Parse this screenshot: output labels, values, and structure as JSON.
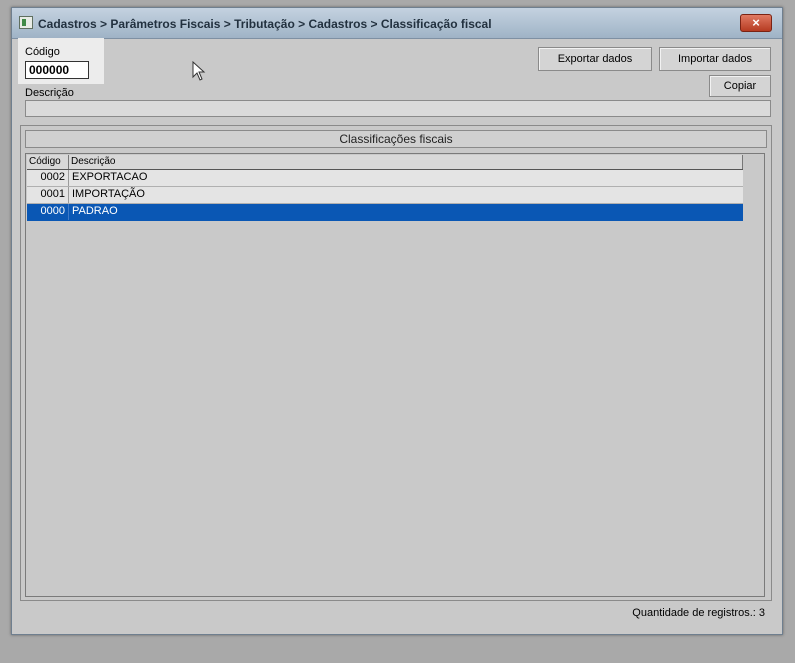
{
  "window": {
    "title": "Cadastros > Parâmetros Fiscais > Tributação > Cadastros > Classificação fiscal",
    "close_symbol": "×"
  },
  "form": {
    "codigo_label": "Código",
    "codigo_value": "000000",
    "descricao_label": "Descrição",
    "descricao_value": ""
  },
  "toolbar": {
    "exportar_label": "Exportar dados",
    "importar_label": "Importar dados",
    "copiar_label": "Copiar"
  },
  "grid": {
    "title": "Classificações fiscais",
    "columns": {
      "codigo": "Código",
      "descricao": "Descrição"
    },
    "rows": [
      {
        "codigo": "0002",
        "descricao": "EXPORTACAO"
      },
      {
        "codigo": "0001",
        "descricao": "IMPORTAÇÃO"
      },
      {
        "codigo": "0000",
        "descricao": "PADRAO"
      }
    ],
    "selected_index": 2
  },
  "footer": {
    "record_count_text": "Quantidade de registros.: 3"
  },
  "colors": {
    "selection": "#0a57b4",
    "window_bg": "#c9c9c9",
    "close_button": "#c14a31"
  },
  "icons": {
    "app": "app-icon",
    "close": "close-icon",
    "cursor": "mouse-pointer-icon"
  }
}
